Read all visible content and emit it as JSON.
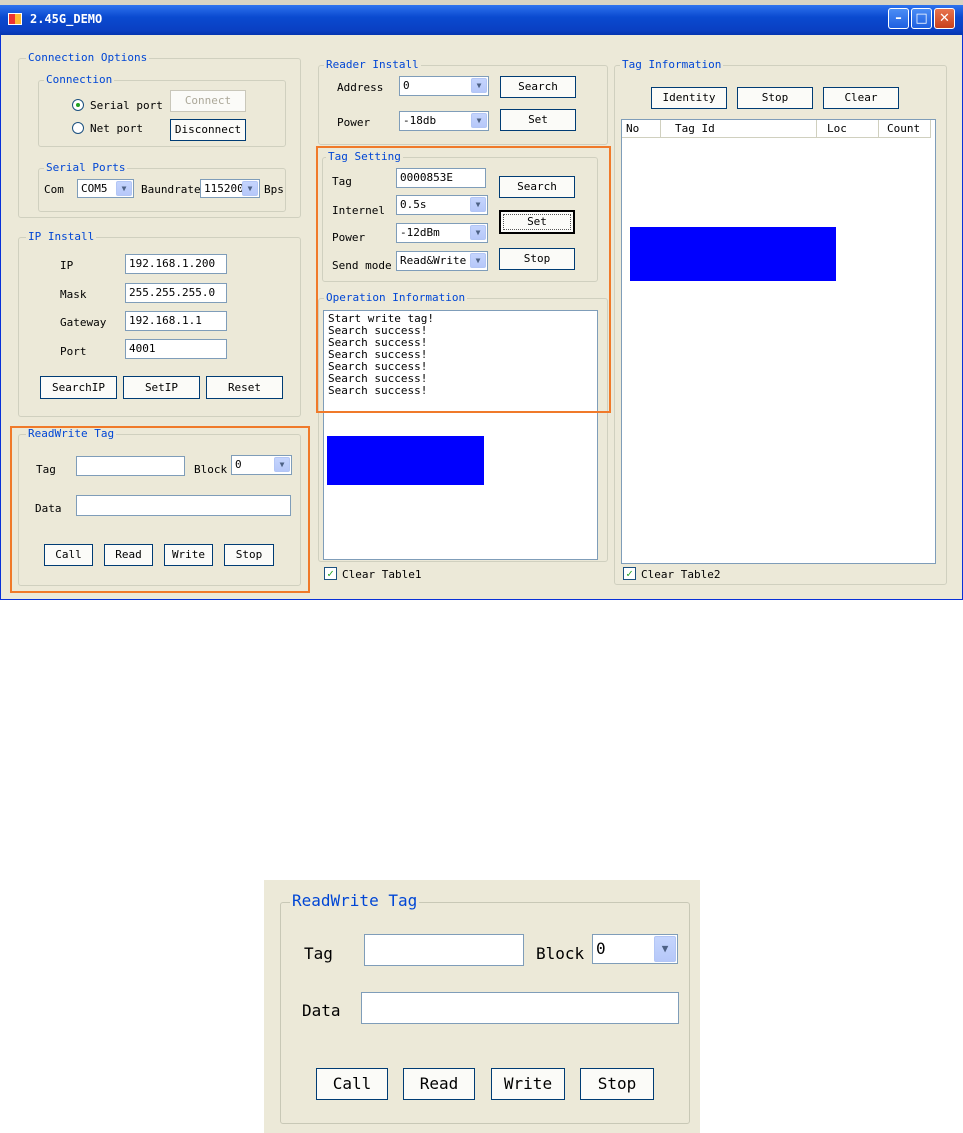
{
  "window": {
    "title": "2.45G_DEMO",
    "controls": [
      "minimize",
      "maximize",
      "close"
    ]
  },
  "connection_options": {
    "label": "Connection Options",
    "connection": {
      "label": "Connection",
      "serial": "Serial port",
      "net": "Net port",
      "selected": "Serial port",
      "connect": "Connect",
      "disconnect": "Disconnect"
    },
    "serial_ports": {
      "label": "Serial Ports",
      "com_label": "Com",
      "com_value": "COM5",
      "baud_label": "Baundrate",
      "baud_value": "115200",
      "unit": "Bps"
    }
  },
  "ip_install": {
    "label": "IP Install",
    "ip_label": "IP",
    "ip": "192.168.1.200",
    "mask_label": "Mask",
    "mask": "255.255.255.0",
    "gateway_label": "Gateway",
    "gateway": "192.168.1.1",
    "port_label": "Port",
    "port": "4001",
    "searchip": "SearchIP",
    "setip": "SetIP",
    "reset": "Reset"
  },
  "readwrite": {
    "label": "ReadWrite Tag",
    "tag_label": "Tag",
    "tag": "",
    "block_label": "Block",
    "block": "0",
    "data_label": "Data",
    "data": "",
    "call": "Call",
    "read": "Read",
    "write": "Write",
    "stop": "Stop"
  },
  "reader_install": {
    "label": "Reader Install",
    "address_label": "Address",
    "address": "0",
    "search": "Search",
    "power_label": "Power",
    "power": "-18db",
    "set": "Set"
  },
  "tag_setting": {
    "label": "Tag Setting",
    "tag_label": "Tag",
    "tag": "0000853E",
    "search": "Search",
    "internel_label": "Internel",
    "internel": "0.5s",
    "set": "Set",
    "power_label": "Power",
    "power": "-12dBm",
    "send_label": "Send mode",
    "send": "Read&Write",
    "stop": "Stop"
  },
  "operation": {
    "label": "Operation Information",
    "log": [
      "Start write tag!",
      "Search success!",
      "Search success!",
      "Search success!",
      "Search success!",
      "Search success!",
      "Search success!"
    ],
    "clear_table": "Clear Table1",
    "clear_checked": true
  },
  "tag_info": {
    "label": "Tag Information",
    "identity": "Identity",
    "stop": "Stop",
    "clear": "Clear",
    "columns": [
      "No",
      "Tag Id",
      "Loc",
      "Count"
    ],
    "clear_table": "Clear Table2",
    "clear_checked": true
  },
  "colors": {
    "highlight": "#f07a2a",
    "redaction": "#0000ff",
    "groupbox_label": "#0046d5",
    "titlebar": "#0a4ad0"
  },
  "icons": {
    "arrow": "▼",
    "check": "✓"
  }
}
